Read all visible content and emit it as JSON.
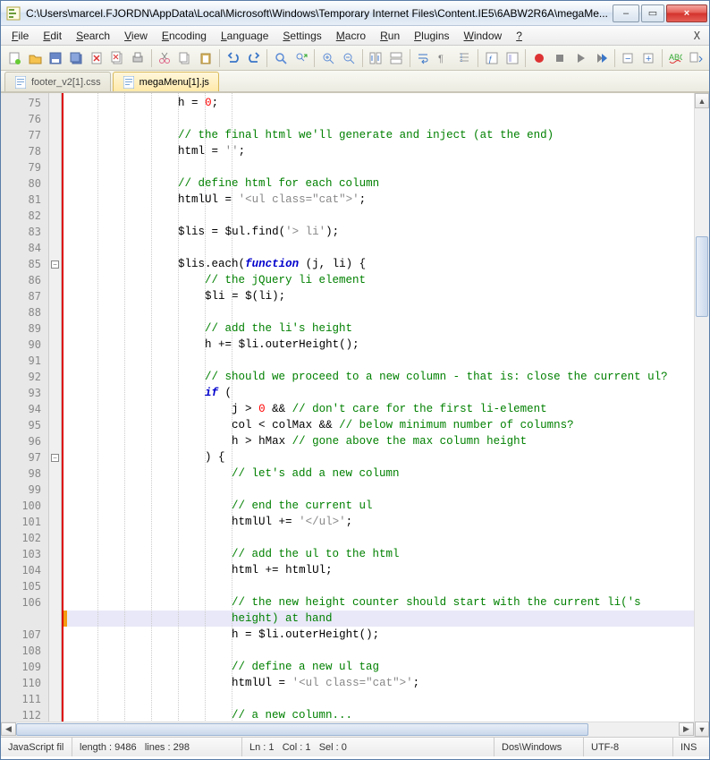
{
  "window": {
    "title": "C:\\Users\\marcel.FJORDN\\AppData\\Local\\Microsoft\\Windows\\Temporary Internet Files\\Content.IE5\\6ABW2R6A\\megaMe...",
    "min": "–",
    "max": "▭",
    "close": "×"
  },
  "menu": {
    "items": [
      "File",
      "Edit",
      "Search",
      "View",
      "Encoding",
      "Language",
      "Settings",
      "Macro",
      "Run",
      "Plugins",
      "Window",
      "?"
    ],
    "close_doc": "X"
  },
  "tabs": {
    "0": {
      "label": "footer_v2[1].css"
    },
    "1": {
      "label": "megaMenu[1].js"
    }
  },
  "gutter_start": 75,
  "code": {
    "75": {
      "indent": 4,
      "tokens": [
        {
          "t": "id",
          "v": "h "
        },
        {
          "t": "op",
          "v": "= "
        },
        {
          "t": "num",
          "v": "0"
        },
        {
          "t": "op",
          "v": ";"
        }
      ]
    },
    "76": {
      "indent": 4,
      "tokens": []
    },
    "77": {
      "indent": 4,
      "tokens": [
        {
          "t": "cm",
          "v": "// the final html we'll generate and inject (at the end)"
        }
      ]
    },
    "78": {
      "indent": 4,
      "tokens": [
        {
          "t": "id",
          "v": "html "
        },
        {
          "t": "op",
          "v": "= "
        },
        {
          "t": "str",
          "v": "''"
        },
        {
          "t": "op",
          "v": ";"
        }
      ]
    },
    "79": {
      "indent": 4,
      "tokens": []
    },
    "80": {
      "indent": 4,
      "tokens": [
        {
          "t": "cm",
          "v": "// define html for each column"
        }
      ]
    },
    "81": {
      "indent": 4,
      "tokens": [
        {
          "t": "id",
          "v": "htmlUl "
        },
        {
          "t": "op",
          "v": "= "
        },
        {
          "t": "str",
          "v": "'<ul class=\"cat\">'"
        },
        {
          "t": "op",
          "v": ";"
        }
      ]
    },
    "82": {
      "indent": 4,
      "tokens": []
    },
    "83": {
      "indent": 4,
      "tokens": [
        {
          "t": "id",
          "v": "$lis "
        },
        {
          "t": "op",
          "v": "= "
        },
        {
          "t": "id",
          "v": "$ul.find"
        },
        {
          "t": "op",
          "v": "("
        },
        {
          "t": "str",
          "v": "'> li'"
        },
        {
          "t": "op",
          "v": ");"
        }
      ]
    },
    "84": {
      "indent": 4,
      "tokens": []
    },
    "85": {
      "indent": 4,
      "fold": true,
      "tokens": [
        {
          "t": "id",
          "v": "$lis.each"
        },
        {
          "t": "op",
          "v": "("
        },
        {
          "t": "kw",
          "v": "function"
        },
        {
          "t": "op",
          "v": " (j, li) {"
        }
      ]
    },
    "86": {
      "indent": 5,
      "tokens": [
        {
          "t": "cm",
          "v": "// the jQuery li element"
        }
      ]
    },
    "87": {
      "indent": 5,
      "tokens": [
        {
          "t": "id",
          "v": "$li "
        },
        {
          "t": "op",
          "v": "= "
        },
        {
          "t": "id",
          "v": "$"
        },
        {
          "t": "op",
          "v": "(li);"
        }
      ]
    },
    "88": {
      "indent": 4,
      "tokens": []
    },
    "89": {
      "indent": 5,
      "tokens": [
        {
          "t": "cm",
          "v": "// add the li's height"
        }
      ]
    },
    "90": {
      "indent": 5,
      "tokens": [
        {
          "t": "id",
          "v": "h "
        },
        {
          "t": "op",
          "v": "+= "
        },
        {
          "t": "id",
          "v": "$li.outerHeight"
        },
        {
          "t": "op",
          "v": "();"
        }
      ]
    },
    "91": {
      "indent": 4,
      "tokens": []
    },
    "92": {
      "indent": 5,
      "tokens": [
        {
          "t": "cm",
          "v": "// should we proceed to a new column - that is: close the current ul?"
        }
      ]
    },
    "93": {
      "indent": 5,
      "tokens": [
        {
          "t": "kw",
          "v": "if"
        },
        {
          "t": "op",
          "v": " ("
        }
      ]
    },
    "94": {
      "indent": 6,
      "tokens": [
        {
          "t": "id",
          "v": "j "
        },
        {
          "t": "op",
          "v": "> "
        },
        {
          "t": "num",
          "v": "0"
        },
        {
          "t": "op",
          "v": " && "
        },
        {
          "t": "cm",
          "v": "// don't care for the first li-element"
        }
      ]
    },
    "95": {
      "indent": 6,
      "tokens": [
        {
          "t": "id",
          "v": "col "
        },
        {
          "t": "op",
          "v": "< "
        },
        {
          "t": "id",
          "v": "colMax "
        },
        {
          "t": "op",
          "v": "&& "
        },
        {
          "t": "cm",
          "v": "// below minimum number of columns?"
        }
      ]
    },
    "96": {
      "indent": 6,
      "tokens": [
        {
          "t": "id",
          "v": "h "
        },
        {
          "t": "op",
          "v": "> "
        },
        {
          "t": "id",
          "v": "hMax "
        },
        {
          "t": "cm",
          "v": "// gone above the max column height"
        }
      ]
    },
    "97": {
      "indent": 5,
      "fold": true,
      "tokens": [
        {
          "t": "op",
          "v": ") {"
        }
      ]
    },
    "98": {
      "indent": 6,
      "tokens": [
        {
          "t": "cm",
          "v": "// let's add a new column"
        }
      ]
    },
    "99": {
      "indent": 4,
      "tokens": []
    },
    "100": {
      "indent": 6,
      "tokens": [
        {
          "t": "cm",
          "v": "// end the current ul"
        }
      ]
    },
    "101": {
      "indent": 6,
      "tokens": [
        {
          "t": "id",
          "v": "htmlUl "
        },
        {
          "t": "op",
          "v": "+= "
        },
        {
          "t": "str",
          "v": "'</ul>'"
        },
        {
          "t": "op",
          "v": ";"
        }
      ]
    },
    "102": {
      "indent": 4,
      "tokens": []
    },
    "103": {
      "indent": 6,
      "tokens": [
        {
          "t": "cm",
          "v": "// add the ul to the html"
        }
      ]
    },
    "104": {
      "indent": 6,
      "tokens": [
        {
          "t": "id",
          "v": "html "
        },
        {
          "t": "op",
          "v": "+= "
        },
        {
          "t": "id",
          "v": "htmlUl"
        },
        {
          "t": "op",
          "v": ";"
        }
      ]
    },
    "105": {
      "indent": 4,
      "tokens": []
    },
    "106": {
      "indent": 6,
      "wrap2": true,
      "tokens": [
        {
          "t": "cm",
          "v": "// the new height counter should start with the current li('s height) at hand"
        }
      ]
    },
    "107": {
      "indent": 6,
      "tokens": [
        {
          "t": "id",
          "v": "h "
        },
        {
          "t": "op",
          "v": "= "
        },
        {
          "t": "id",
          "v": "$li.outerHeight"
        },
        {
          "t": "op",
          "v": "();"
        }
      ]
    },
    "108": {
      "indent": 4,
      "tokens": []
    },
    "109": {
      "indent": 6,
      "tokens": [
        {
          "t": "cm",
          "v": "// define a new ul tag"
        }
      ]
    },
    "110": {
      "indent": 6,
      "tokens": [
        {
          "t": "id",
          "v": "htmlUl "
        },
        {
          "t": "op",
          "v": "= "
        },
        {
          "t": "str",
          "v": "'<ul class=\"cat\">'"
        },
        {
          "t": "op",
          "v": ";"
        }
      ]
    },
    "111": {
      "indent": 4,
      "tokens": []
    },
    "112": {
      "indent": 6,
      "tokens": [
        {
          "t": "cm",
          "v": "// a new column..."
        }
      ]
    }
  },
  "status": {
    "lang": "JavaScript fil",
    "length_lbl": "length :",
    "length_val": "9486",
    "lines_lbl": "lines :",
    "lines_val": "298",
    "ln_lbl": "Ln :",
    "ln_val": "1",
    "col_lbl": "Col :",
    "col_val": "1",
    "sel_lbl": "Sel :",
    "sel_val": "0",
    "eol": "Dos\\Windows",
    "enc": "UTF-8",
    "ovr": "INS"
  },
  "toolbar_icons": [
    "new",
    "open",
    "save",
    "save-all",
    "close",
    "close-all",
    "print",
    "sep",
    "cut",
    "copy",
    "paste",
    "sep",
    "undo",
    "redo",
    "sep",
    "find",
    "replace",
    "sep",
    "zoom-in",
    "zoom-out",
    "sep",
    "sync-v",
    "sync-h",
    "sep",
    "wrap",
    "all-chars",
    "indent-guide",
    "sep",
    "lang",
    "doc-map",
    "sep",
    "rec",
    "stop",
    "play",
    "play-multi",
    "sep",
    "fold",
    "unfold",
    "sep",
    "spell",
    "doc-switch"
  ]
}
